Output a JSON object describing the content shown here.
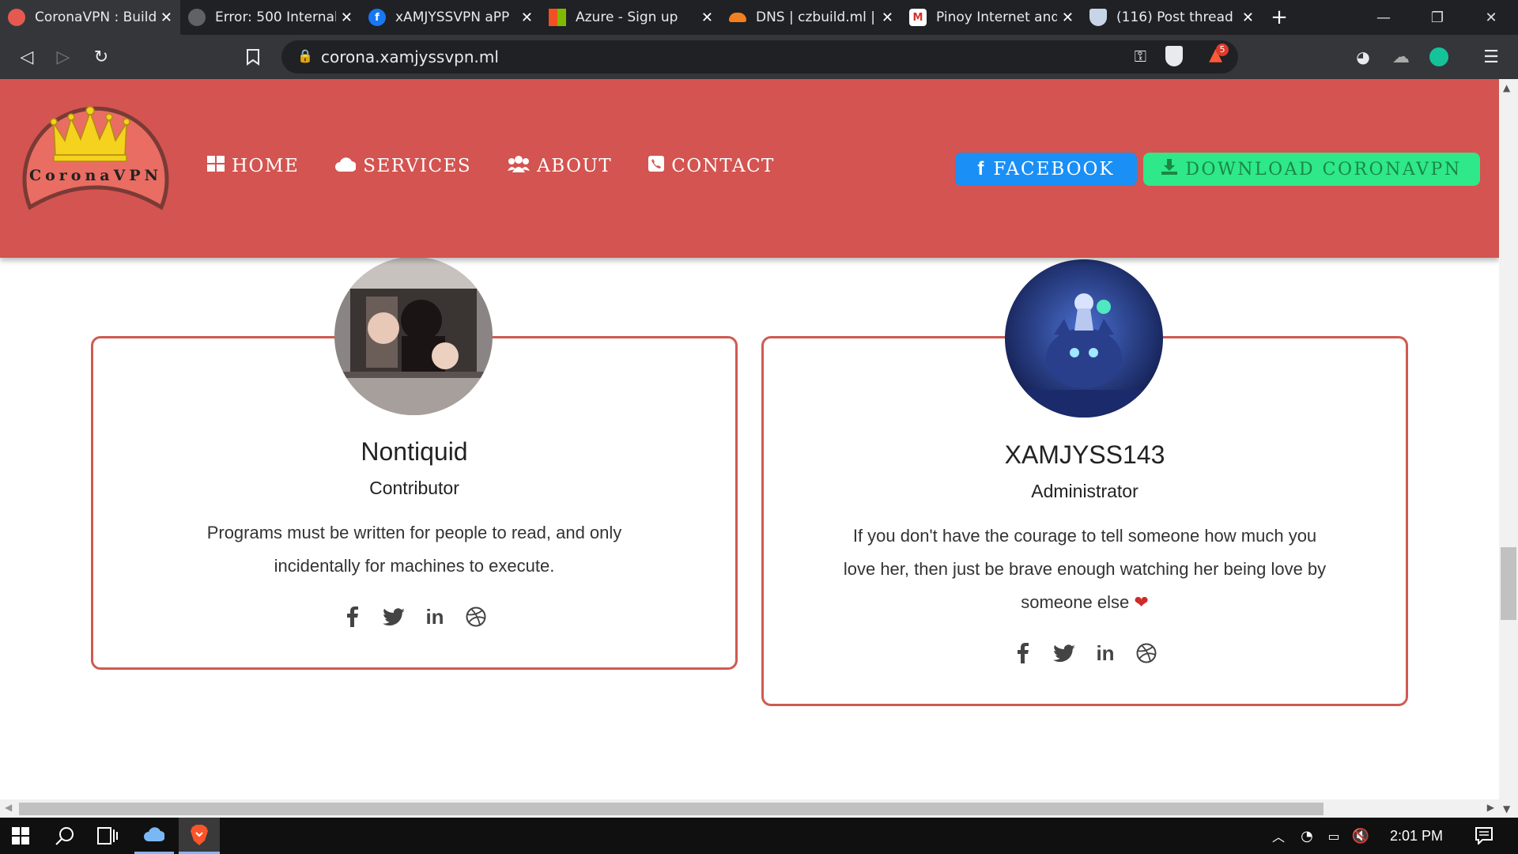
{
  "browser": {
    "tabs": [
      {
        "title": "CoronaVPN : Build",
        "active": true,
        "favicon": "corona-icon"
      },
      {
        "title": "Error: 500 Internal",
        "favicon": "globe-icon"
      },
      {
        "title": "xAMJYSSVPN aPP",
        "favicon": "facebook-icon"
      },
      {
        "title": "Azure - Sign up",
        "favicon": "microsoft-icon"
      },
      {
        "title": "DNS | czbuild.ml |",
        "favicon": "cloudflare-icon"
      },
      {
        "title": "Pinoy Internet and",
        "favicon": "gmail-icon"
      },
      {
        "title": "(116) Post thread",
        "favicon": "shield-icon"
      }
    ],
    "url": "corona.xamjyssvpn.ml",
    "brave_badge": "5"
  },
  "site": {
    "logo_text": "CoronaVPN",
    "nav": [
      {
        "label": "HOME",
        "icon": "windows-grid-icon"
      },
      {
        "label": "SERVICES",
        "icon": "cloud-icon"
      },
      {
        "label": "ABOUT",
        "icon": "users-icon"
      },
      {
        "label": "CONTACT",
        "icon": "phone-icon"
      }
    ],
    "facebook_label": "FACEBOOK",
    "download_label": "DOWNLOAD CORONAVPN",
    "colors": {
      "header": "#d35450",
      "facebook": "#1a8ff5",
      "download": "#2ee88a",
      "card_border": "#cf5a51"
    }
  },
  "team": [
    {
      "name": "Nontiquid",
      "role": "Contributor",
      "quote_lines": [
        "Programs must be written for people to read, and only",
        "incidentally for machines to execute."
      ]
    },
    {
      "name": "XAMJYSS143",
      "role": "Administrator",
      "quote_lines": [
        "If you don't have the courage to tell someone how much you",
        "love her, then just be brave enough watching her being love by",
        "someone else"
      ]
    }
  ],
  "taskbar": {
    "time": "2:01 PM"
  }
}
